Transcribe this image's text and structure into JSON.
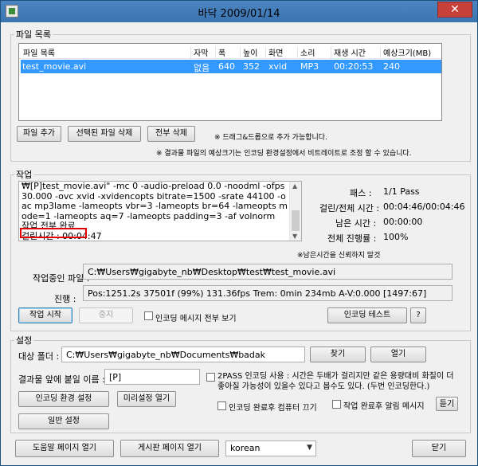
{
  "window": {
    "title": "바닥 2009/01/14",
    "close_glyph": "✕"
  },
  "file_list": {
    "legend": "파일 목록",
    "columns": [
      "파일 목록",
      "자막",
      "폭",
      "높이",
      "화면",
      "소리",
      "재생 시간",
      "예상크기(MB)"
    ],
    "rows": [
      {
        "name": "test_movie.avi",
        "subtitle": "없음",
        "width": "640",
        "height": "352",
        "video": "xvid",
        "audio": "MP3",
        "duration": "00:20:53",
        "size": "240"
      }
    ],
    "add_button": "파일 추가",
    "remove_selected_button": "선택된 파일 삭제",
    "remove_all_button": "전부 삭제",
    "note1": "※ 드래그&드롭으로 추가 가능합니다.",
    "note2": "※ 결과물 파일의 예상크기는 인코딩 환경설정에서 비트레이트로 조정 할 수 있습니다."
  },
  "job": {
    "legend": "작업",
    "log_text": "₩[P]test_movie.avi\" -mc 0 -audio-preload 0.0 -noodml -ofps 30.000 -ovc xvid -xvidencopts bitrate=1500 -srate 44100 -oac mp3lame -lameopts vbr=3 -lameopts br=64 -lameopts mode=1 -lameopts aq=7 -lameopts padding=3 -af volnorm\n작업 전부 완료\n걸린시간 : 00:04:47",
    "pass_label": "패스 :",
    "pass_value": "1/1 Pass",
    "elapsed_label": "걸린/전체 시간 :",
    "elapsed_value": "00:04:46/00:04:46",
    "remaining_label": "남은 시간 :",
    "remaining_value": "00:00:00",
    "overall_label": "전체 진행률 :",
    "overall_value": "100%",
    "remaining_note": "※남은시간을 신뢰하지 말것",
    "current_file_label": "작업중인 파일 :",
    "current_file_value": "C:₩Users₩gigabyte_nb₩Desktop₩test₩test_movie.avi",
    "progress_label": "진행 :",
    "progress_value": "Pos:1251.2s  37501f (99%) 131.36fps Trem:    0min 234mb  A-V:0.000 [1497:67]",
    "start_button": "작업 시작",
    "stop_button": "중지",
    "show_all_messages_label": "인코딩 메시지 전부 보기",
    "encode_test_button": "인코딩 테스트",
    "help_button": "?"
  },
  "settings": {
    "legend": "설정",
    "target_folder_label": "대상 폴더 :",
    "target_folder_value": "C:₩Users₩gigabyte_nb₩Documents₩badak",
    "find_button": "찾기",
    "open_button": "열기",
    "prefix_label": "결과물 앞에 붙일 이름 :",
    "prefix_value": "[P]",
    "twopass_label": "2PASS 인코딩 사용 : 시간은 두배가 걸리지만 같은 용량대비 화질이 더 좋아질 가능성이 있을수 있다고 봅수도 있다. (두번 인코딩한다.)",
    "encode_settings_button": "인코딩 환경 설정",
    "preset_open_button": "미리설정 열기",
    "general_settings_button": "일반 설정",
    "shutdown_label": "인코딩 완료후 컴퓨터 끄기",
    "notify_label": "작업 완료후 알림 메시지",
    "hide_button": "듣기"
  },
  "footer": {
    "help_page_button": "도움말 페이지 열기",
    "board_page_button": "게시판 페이지 열기",
    "language_value": "korean",
    "close_button": "닫기"
  }
}
